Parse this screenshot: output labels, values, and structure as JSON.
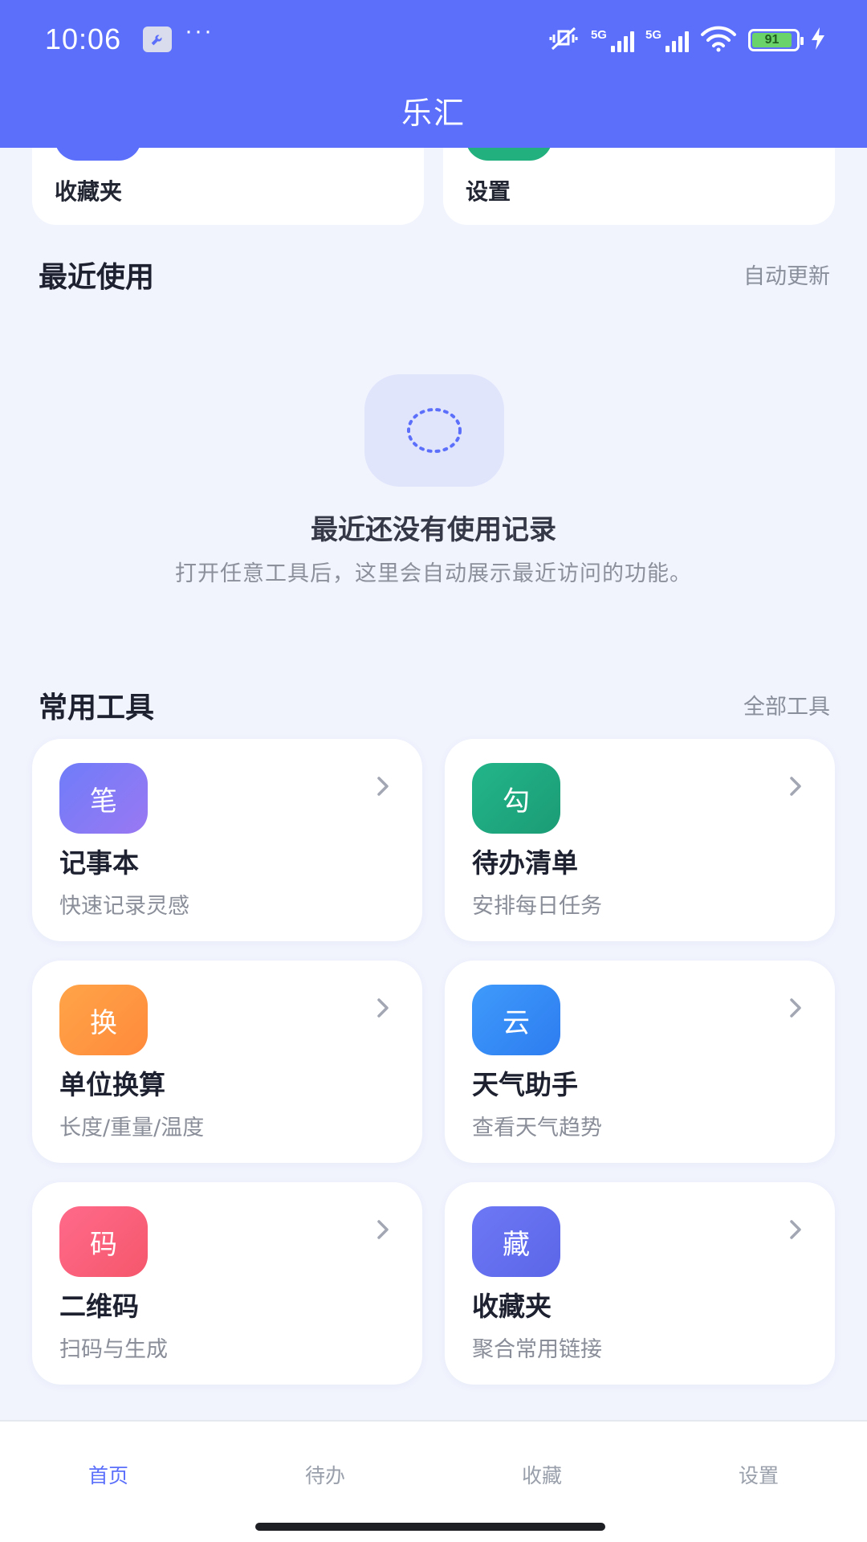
{
  "status_bar": {
    "time": "10:06",
    "more": "···",
    "signal_label_1": "5G",
    "signal_label_2": "5G",
    "battery": "91"
  },
  "header": {
    "title": "乐汇"
  },
  "top_cards": [
    {
      "label": "收藏夹",
      "icon_color": "#5b6ffb"
    },
    {
      "label": "设置",
      "icon_color": "#22b07e"
    }
  ],
  "recent": {
    "title": "最近使用",
    "link": "自动更新",
    "empty_title": "最近还没有使用记录",
    "empty_sub": "打开任意工具后，这里会自动展示最近访问的功能。"
  },
  "tools": {
    "title": "常用工具",
    "link": "全部工具",
    "items": [
      {
        "glyph": "笔",
        "name": "记事本",
        "desc": "快速记录灵感",
        "color_from": "#6f7cf9",
        "color_to": "#9a78f2"
      },
      {
        "glyph": "勾",
        "name": "待办清单",
        "desc": "安排每日任务",
        "color_from": "#23b58a",
        "color_to": "#1b9c75"
      },
      {
        "glyph": "换",
        "name": "单位换算",
        "desc": "长度/重量/温度",
        "color_from": "#ffa448",
        "color_to": "#ff8a3b"
      },
      {
        "glyph": "云",
        "name": "天气助手",
        "desc": "查看天气趋势",
        "color_from": "#3f9bfb",
        "color_to": "#2d7cf0"
      },
      {
        "glyph": "码",
        "name": "二维码",
        "desc": "扫码与生成",
        "color_from": "#ff6a8a",
        "color_to": "#f5576c"
      },
      {
        "glyph": "藏",
        "name": "收藏夹",
        "desc": "聚合常用链接",
        "color_from": "#6d78f5",
        "color_to": "#5b66e8"
      }
    ]
  },
  "bottom_nav": [
    {
      "label": "首页",
      "active": true
    },
    {
      "label": "待办",
      "active": false
    },
    {
      "label": "收藏",
      "active": false
    },
    {
      "label": "设置",
      "active": false
    }
  ],
  "colors": {
    "accent": "#5b6ffb",
    "background": "#f1f4fd"
  }
}
